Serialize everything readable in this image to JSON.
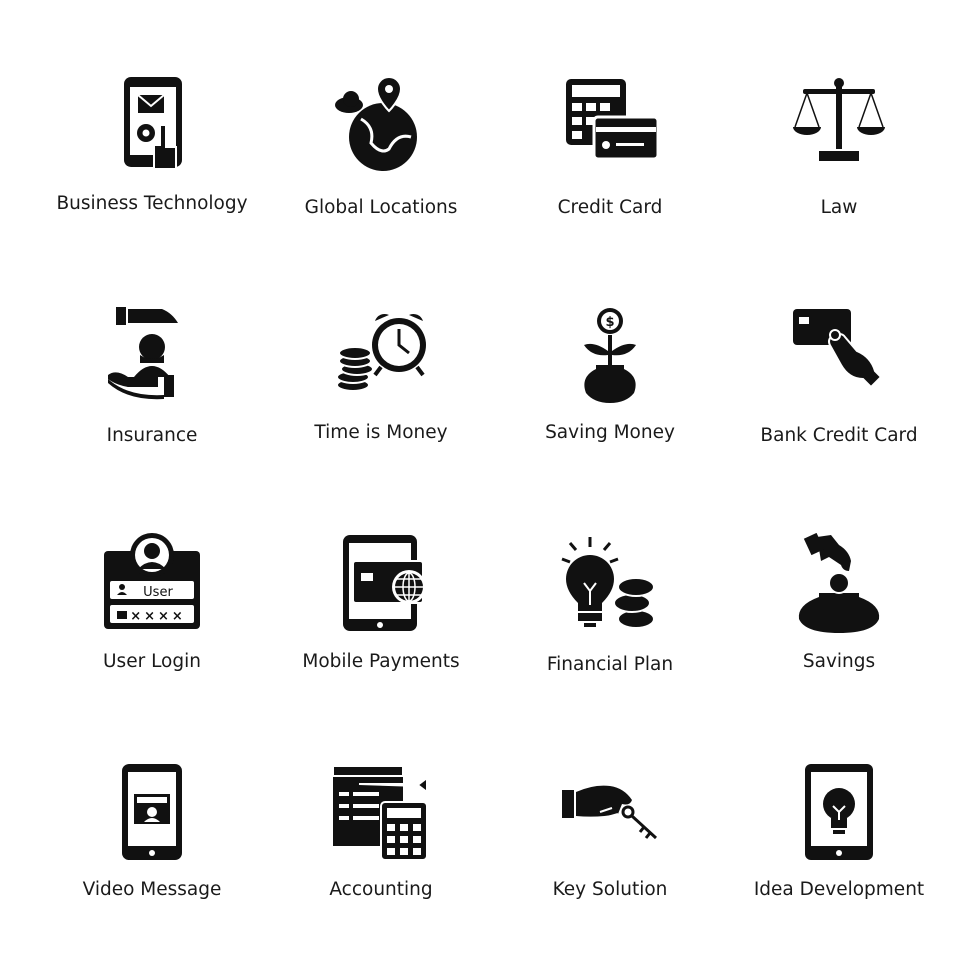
{
  "icons": [
    {
      "label": "Business Technology",
      "icon": "mobile-settings-touch-icon"
    },
    {
      "label": "Global Locations",
      "icon": "globe-location-pin-icon"
    },
    {
      "label": "Credit Card",
      "icon": "calculator-credit-card-icon"
    },
    {
      "label": "Law",
      "icon": "scales-of-justice-icon"
    },
    {
      "label": "Insurance",
      "icon": "hands-protecting-person-icon"
    },
    {
      "label": "Time is Money",
      "icon": "alarm-clock-coins-icon"
    },
    {
      "label": "Saving Money",
      "icon": "money-plant-pot-icon"
    },
    {
      "label": "Bank Credit Card",
      "icon": "hand-holding-card-icon"
    },
    {
      "label": "User Login",
      "icon": "user-login-card-icon"
    },
    {
      "label": "Mobile Payments",
      "icon": "tablet-card-globe-icon"
    },
    {
      "label": "Financial Plan",
      "icon": "lightbulb-coins-icon"
    },
    {
      "label": "Savings",
      "icon": "hand-coin-pot-icon"
    },
    {
      "label": "Video Message",
      "icon": "phone-video-icon"
    },
    {
      "label": "Accounting",
      "icon": "document-calculator-icon"
    },
    {
      "label": "Key Solution",
      "icon": "hand-key-icon"
    },
    {
      "label": "Idea Development",
      "icon": "phone-lightbulb-icon"
    }
  ],
  "login_card": {
    "user_text": "User",
    "password_mask": "××××"
  },
  "colors": {
    "icon": "#111111",
    "background": "#ffffff"
  }
}
